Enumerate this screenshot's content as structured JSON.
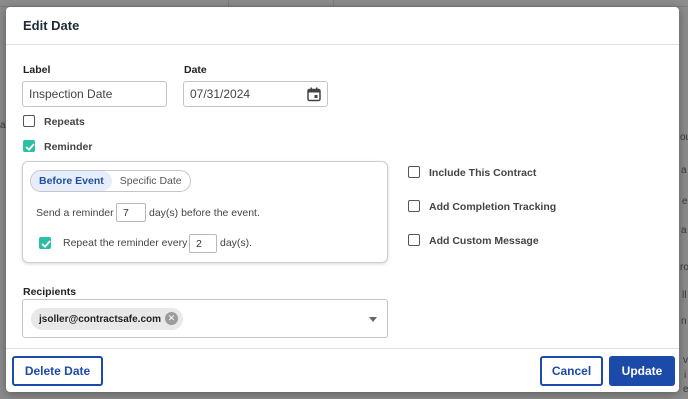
{
  "background": {
    "fragments": [
      "a",
      "ou",
      "a",
      "e",
      "a",
      "ro",
      "ll",
      "n",
      "v",
      "i",
      "e"
    ]
  },
  "modal": {
    "title": "Edit Date",
    "label_field": {
      "label": "Label",
      "value": "Inspection Date"
    },
    "date_field": {
      "label": "Date",
      "value": "07/31/2024"
    },
    "repeats": {
      "label": "Repeats",
      "checked": false
    },
    "reminder": {
      "label": "Reminder",
      "checked": true,
      "tabs": [
        "Before Event",
        "Specific Date"
      ],
      "active_tab": "Before Event",
      "send_prefix": "Send a reminder",
      "send_days": "7",
      "send_suffix": "day(s) before the event.",
      "repeat_checked": true,
      "repeat_prefix": "Repeat the reminder every",
      "repeat_days": "2",
      "repeat_suffix": "day(s)."
    },
    "options": [
      {
        "label": "Include This Contract",
        "checked": false
      },
      {
        "label": "Add Completion Tracking",
        "checked": false
      },
      {
        "label": "Add Custom Message",
        "checked": false
      }
    ],
    "recipients": {
      "label": "Recipients",
      "chips": [
        "jsoller@contractsafe.com"
      ]
    },
    "footer": {
      "delete_label": "Delete Date",
      "cancel_label": "Cancel",
      "update_label": "Update"
    }
  },
  "colors": {
    "accent": "#1c4aa8",
    "check": "#2bbfa4",
    "active_tab_bg": "#e6eefc"
  }
}
